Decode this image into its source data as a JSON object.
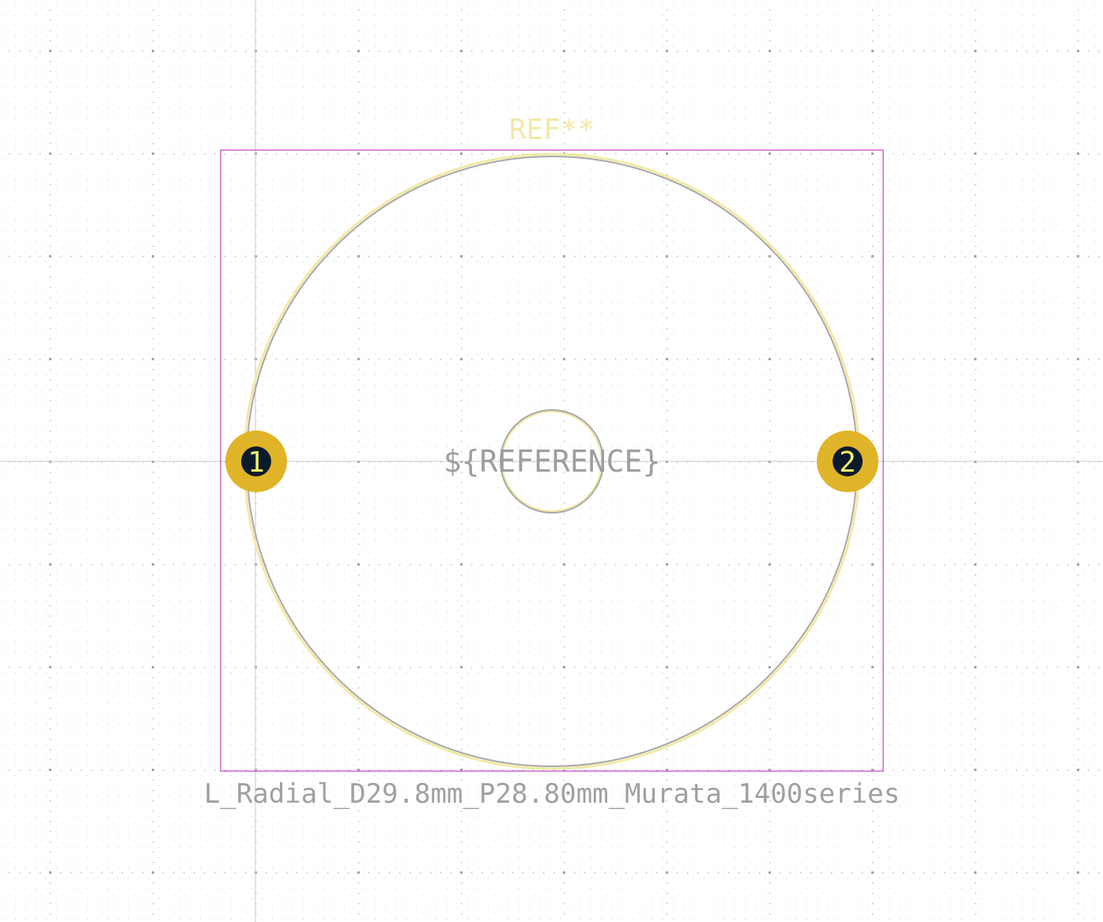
{
  "footprint": {
    "ref_label": "REF**",
    "value_label": "${REFERENCE}",
    "name_label": "L_Radial_D29.8mm_P28.80mm_Murata_1400series",
    "pads": [
      {
        "number": "1"
      },
      {
        "number": "2"
      }
    ]
  },
  "colors": {
    "background": "#ffffff",
    "grid_dot": "#bdbdbd",
    "axis_line": "#c8c8c8",
    "courtyard": "#c33ec3",
    "silkscreen": "#f2e9a6",
    "fab": "#a8a8a8",
    "pad": "#e0b428",
    "drill": "#0b1a2b",
    "pad_number": "#f4f06a",
    "ref_text": "#f2e9a6",
    "value_text": "#9e9e9e",
    "name_text": "#a0a0a0"
  }
}
